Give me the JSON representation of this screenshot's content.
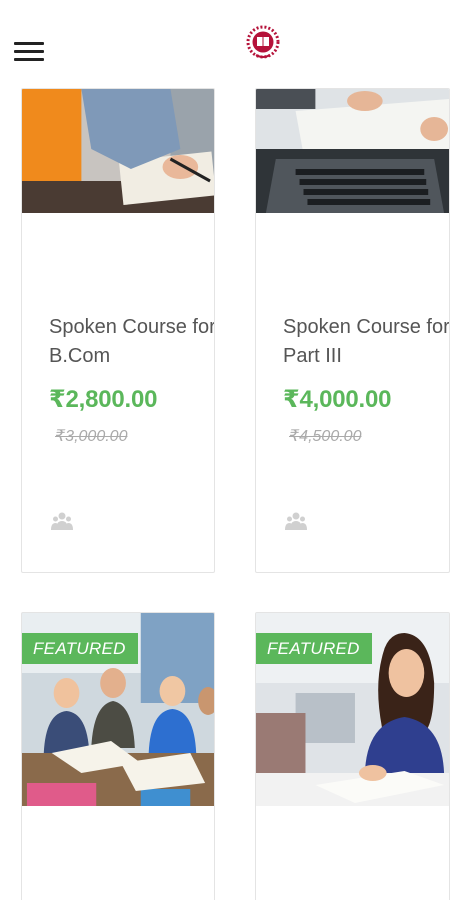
{
  "header": {
    "menu_icon": "hamburger-menu-icon",
    "logo_icon": "institute-crest-logo"
  },
  "colors": {
    "accent_green": "#5bb75b",
    "title_gray": "#555555",
    "old_price_gray": "#aaaaaa"
  },
  "courses": [
    {
      "title": "Spoken Course for B.Com",
      "price": "₹2,800.00",
      "old_price": "₹3,000.00",
      "image": "person-writing-notebook"
    },
    {
      "title": "Spoken Course for Part III",
      "price": "₹4,000.00",
      "old_price": "₹4,500.00",
      "image": "laptop-and-notes"
    }
  ],
  "featured_courses": [
    {
      "badge": "FEATURED",
      "image": "students-group-smiling"
    },
    {
      "badge": "FEATURED",
      "image": "woman-writing-at-desk"
    }
  ]
}
